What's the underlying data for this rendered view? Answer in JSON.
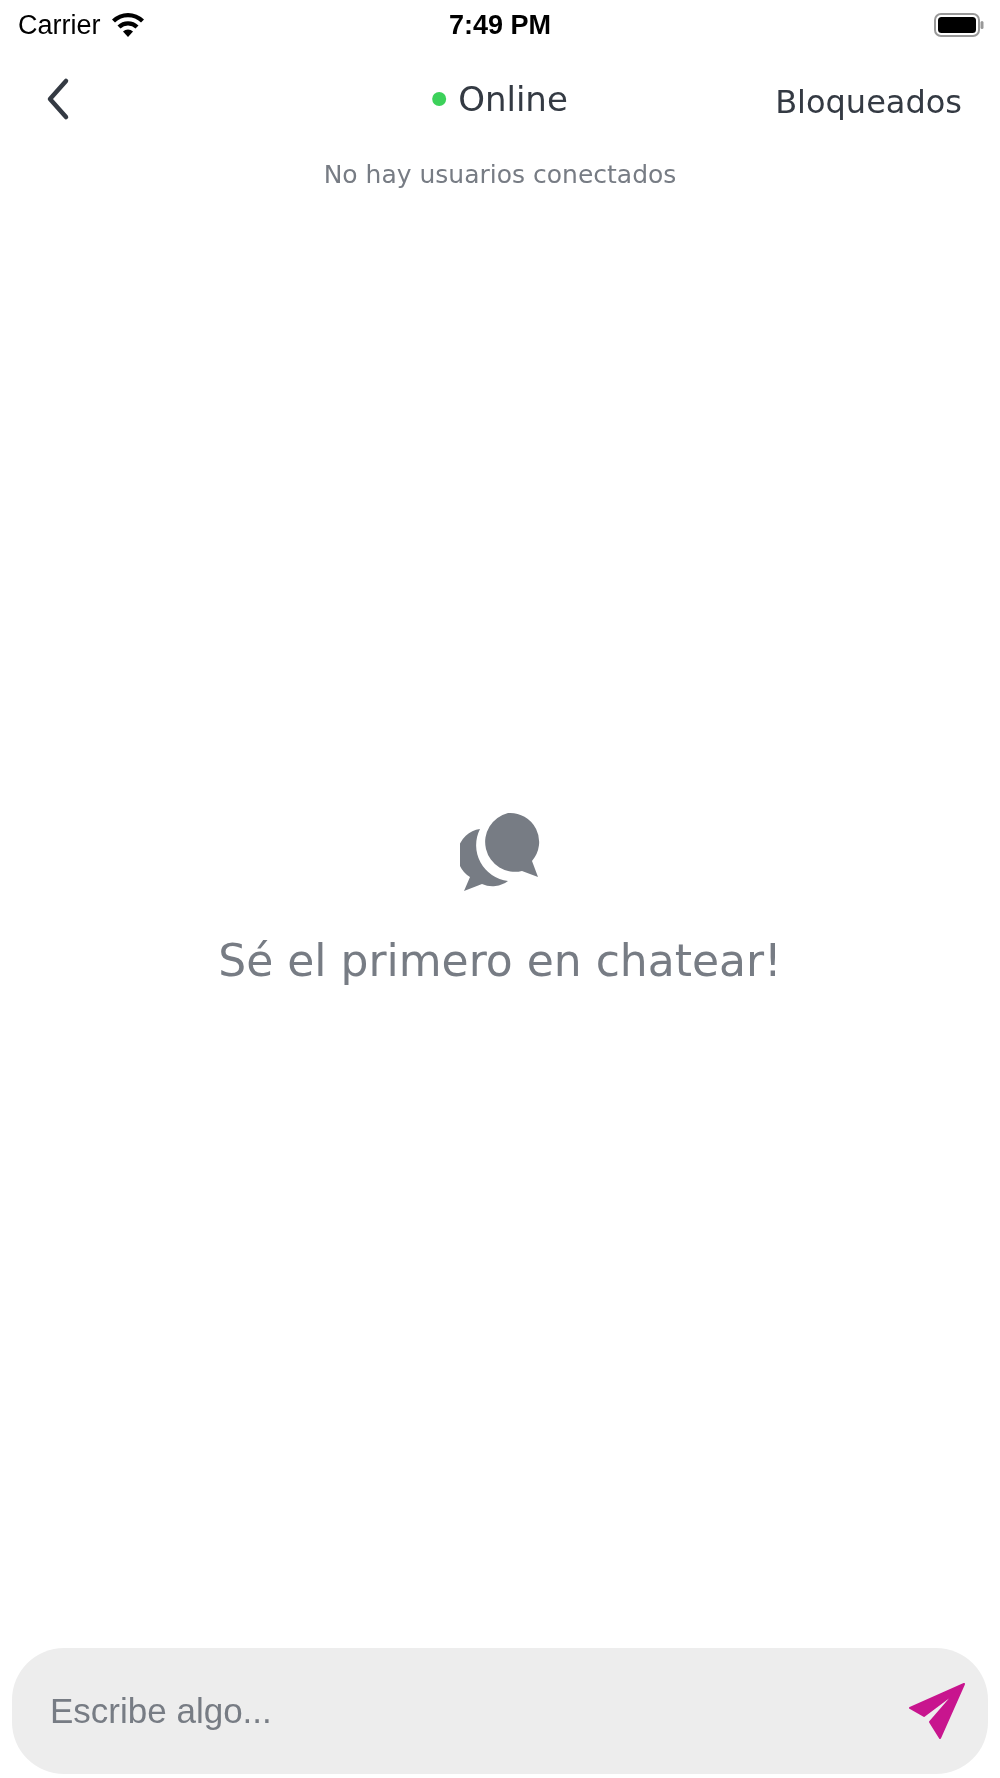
{
  "status_bar": {
    "carrier": "Carrier",
    "time": "7:49 PM"
  },
  "header": {
    "title": "Online",
    "online": true,
    "right_button": "Bloqueados"
  },
  "subtitle": "No hay usuarios conectados",
  "empty_state": {
    "message": "Sé el primero en chatear!"
  },
  "composer": {
    "placeholder": "Escribe algo..."
  }
}
